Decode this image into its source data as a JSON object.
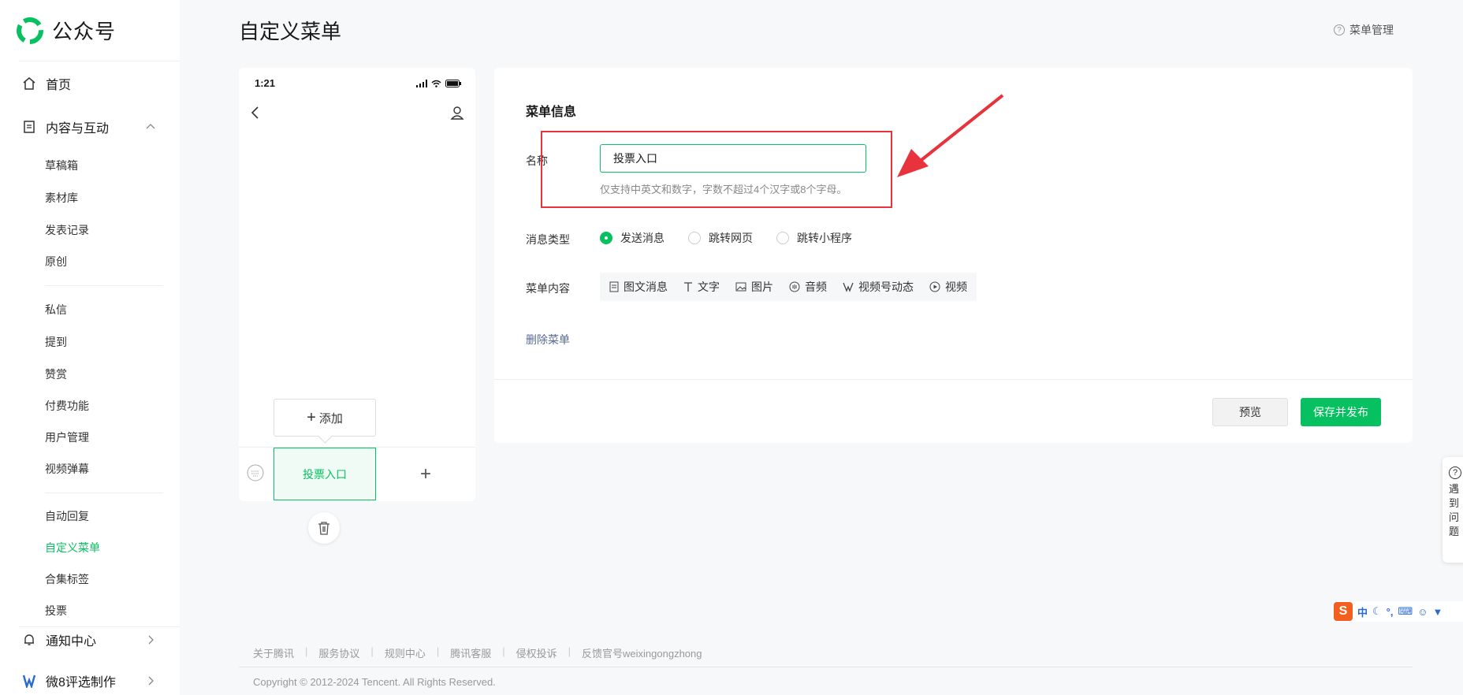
{
  "app": {
    "name": "公众号"
  },
  "colors": {
    "accent": "#07c160",
    "highlight_box": "#e8323c",
    "link": "#576b95"
  },
  "sidebar": {
    "home": {
      "label": "首页",
      "icon": "home-icon"
    },
    "content_section": {
      "label": "内容与互动",
      "icon": "document-icon",
      "expanded": true
    },
    "content_items": [
      {
        "label": "草稿箱"
      },
      {
        "label": "素材库"
      },
      {
        "label": "发表记录"
      },
      {
        "label": "原创"
      },
      {
        "label": "私信"
      },
      {
        "label": "提到"
      },
      {
        "label": "赞赏"
      },
      {
        "label": "付费功能"
      },
      {
        "label": "用户管理"
      },
      {
        "label": "视频弹幕"
      },
      {
        "label": "自动回复"
      },
      {
        "label": "自定义菜单",
        "active": true
      },
      {
        "label": "合集标签"
      },
      {
        "label": "投票"
      }
    ],
    "notification": {
      "label": "通知中心",
      "icon": "bell-icon"
    },
    "account": {
      "label": "微8评选制作"
    }
  },
  "header": {
    "title": "自定义菜单",
    "help_label": "菜单管理"
  },
  "phone": {
    "time": "1:21",
    "add_label": "添加",
    "menu_item_label": "投票入口",
    "add_menu_symbol": "+"
  },
  "editor": {
    "section_title": "菜单信息",
    "name_label": "名称",
    "name_value": "投票入口",
    "name_hint": "仅支持中英文和数字，字数不超过4个汉字或8个字母。",
    "type_label": "消息类型",
    "type_options": [
      {
        "label": "发送消息",
        "selected": true
      },
      {
        "label": "跳转网页",
        "selected": false
      },
      {
        "label": "跳转小程序",
        "selected": false
      }
    ],
    "content_label": "菜单内容",
    "content_tabs": [
      {
        "label": "图文消息",
        "icon": "article-icon"
      },
      {
        "label": "文字",
        "icon": "text-icon"
      },
      {
        "label": "图片",
        "icon": "image-icon"
      },
      {
        "label": "音频",
        "icon": "audio-icon"
      },
      {
        "label": "视频号动态",
        "icon": "channels-icon"
      },
      {
        "label": "视频",
        "icon": "video-icon"
      }
    ],
    "delete_label": "删除菜单",
    "preview_label": "预览",
    "publish_label": "保存并发布"
  },
  "footer": {
    "links": [
      "关于腾讯",
      "服务协议",
      "规则中心",
      "腾讯客服",
      "侵权投诉",
      "反馈官号weixingongzhong"
    ],
    "copyright": "Copyright © 2012-2024 Tencent. All Rights Reserved."
  },
  "float_help": {
    "lines": [
      "遇",
      "到",
      "问",
      "题"
    ]
  },
  "ime": {
    "logo": "S",
    "mode": "中"
  }
}
